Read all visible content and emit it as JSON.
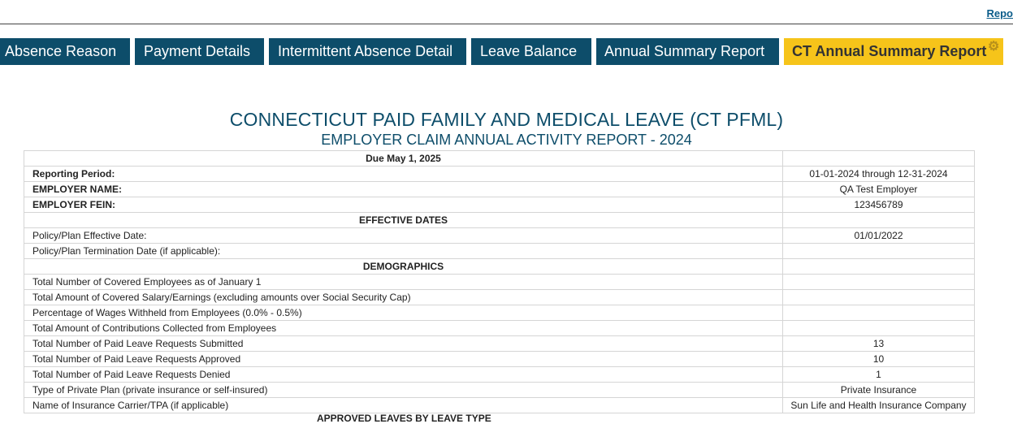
{
  "header": {
    "report_link": "Repo"
  },
  "tabs": [
    {
      "label": "Absence Reason"
    },
    {
      "label": "Payment Details"
    },
    {
      "label": "Intermittent Absence Detail"
    },
    {
      "label": "Leave Balance"
    },
    {
      "label": "Annual Summary Report"
    },
    {
      "label": "CT Annual Summary Report"
    }
  ],
  "report": {
    "title": "CONNECTICUT PAID FAMILY AND MEDICAL LEAVE (CT PFML)",
    "subtitle": "EMPLOYER CLAIM ANNUAL ACTIVITY REPORT - 2024",
    "due": "Due May 1, 2025",
    "rows": [
      {
        "label": "Reporting Period:",
        "value": "01-01-2024 through 12-31-2024"
      },
      {
        "label": "EMPLOYER NAME:",
        "value": "QA Test Employer"
      },
      {
        "label": "EMPLOYER FEIN:",
        "value": "123456789"
      },
      {
        "label": "EFFECTIVE DATES",
        "value": ""
      },
      {
        "label": "Policy/Plan Effective Date:",
        "value": "01/01/2022"
      },
      {
        "label": "Policy/Plan Termination Date (if applicable):",
        "value": ""
      },
      {
        "label": "DEMOGRAPHICS",
        "value": ""
      },
      {
        "label": "Total Number of Covered Employees as of January 1",
        "value": ""
      },
      {
        "label": "Total Amount of Covered Salary/Earnings (excluding amounts over Social Security Cap)",
        "value": ""
      },
      {
        "label": "Percentage of Wages Withheld from Employees (0.0% - 0.5%)",
        "value": ""
      },
      {
        "label": "Total Amount of Contributions Collected from Employees",
        "value": ""
      },
      {
        "label": "Total Number of Paid Leave Requests Submitted",
        "value": "13"
      },
      {
        "label": "Total Number of Paid Leave Requests Approved",
        "value": "10"
      },
      {
        "label": "Total Number of Paid Leave Requests Denied",
        "value": "1"
      },
      {
        "label": "Type of Private Plan (private insurance or self-insured)",
        "value": "Private Insurance"
      },
      {
        "label": "Name of Insurance Carrier/TPA (if applicable)",
        "value": "Sun Life and Health Insurance Company"
      }
    ],
    "partial_row": "APPROVED LEAVES BY LEAVE TYPE"
  }
}
